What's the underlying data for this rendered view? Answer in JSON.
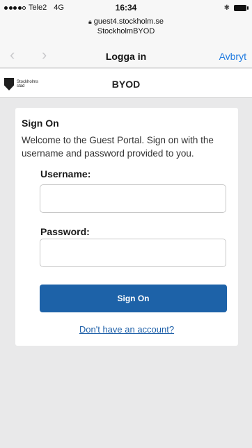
{
  "status_bar": {
    "carrier": "Tele2",
    "network": "4G",
    "time": "16:34",
    "bluetooth_icon": "bluetooth-icon",
    "battery_icon": "battery-icon"
  },
  "browser": {
    "url_host": "guest4.stockholm.se",
    "page_title": "StockholmBYOD",
    "nav_title": "Logga in",
    "cancel_label": "Avbryt",
    "back_icon": "chevron-left-icon",
    "forward_icon": "chevron-right-icon"
  },
  "site": {
    "logo_text_line1": "Stockholms",
    "logo_text_line2": "stad",
    "title": "BYOD"
  },
  "form": {
    "heading": "Sign On",
    "description": "Welcome to the Guest Portal. Sign on with the username and password provided to you.",
    "username_label": "Username:",
    "username_value": "",
    "password_label": "Password:",
    "password_value": "",
    "submit_label": "Sign On",
    "register_link": "Don't have an account?"
  },
  "colors": {
    "background": "#e9e9ea",
    "accent": "#1d62a8",
    "link": "#1d5fa8",
    "ios_blue": "#1f7ae0"
  }
}
